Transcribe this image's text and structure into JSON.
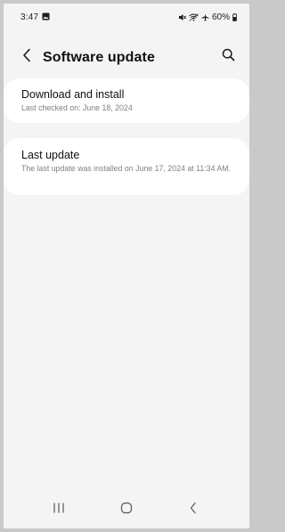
{
  "status_bar": {
    "time": "3:47",
    "battery": "60%"
  },
  "header": {
    "title": "Software update"
  },
  "cards": [
    {
      "title": "Download and install",
      "subtitle": "Last checked on: June 18, 2024"
    },
    {
      "title": "Last update",
      "subtitle": "The last update was installed on June 17, 2024 at 11:34 AM."
    }
  ],
  "icons": {
    "status": [
      "gallery-icon",
      "mute-icon",
      "wifi-icon",
      "airplane-icon",
      "battery-icon"
    ],
    "header": [
      "back-chevron-icon",
      "search-icon"
    ],
    "nav": [
      "recents-icon",
      "home-icon",
      "back-icon"
    ]
  },
  "colors": {
    "background": "#f4f4f4",
    "card": "#ffffff",
    "title_text": "#111111",
    "subtitle_text": "#808080"
  }
}
